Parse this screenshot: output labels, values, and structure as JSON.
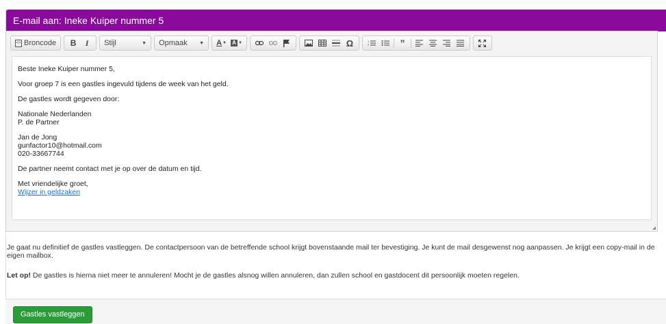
{
  "header": {
    "title": "E-mail aan: Ineke Kuiper nummer 5"
  },
  "toolbar": {
    "source_label": "Broncode",
    "bold_label": "B",
    "italic_label": "I",
    "style_select": "Stijl",
    "format_select": "Opmaak"
  },
  "email": {
    "greeting": "Beste Ineke Kuiper nummer 5,",
    "intro": "Voor groep 7 is een gastles ingevuld tijdens de week van het geld.",
    "given_by": "De gastles wordt gegeven door:",
    "org_line1": "Nationale Nederlanden",
    "org_line2": "P. de Partner",
    "contact_name": "Jan de Jong",
    "contact_email": "gunfactor10@hotmail.com",
    "contact_phone": "020-33667744",
    "followup": "De partner neemt contact met je op over de datum en tijd.",
    "closing": "Met vriendelijke groet,",
    "signature_link": "Wijzer in geldzaken"
  },
  "info_text": "Je gaat nu definitief de gastles vastleggen. De contactpersoon van de betreffende school krijgt bovenstaande mail ter bevestiging. Je kunt de mail desgewenst nog aanpassen. Je krijgt een copy-mail in de eigen mailbox.",
  "warning": {
    "label": "Let op!",
    "text": " De gastles is hierna niet meer te annuleren! Mocht je de gastles alsnog willen annuleren, dan zullen school en gastdocent dit persoonlijk moeten regelen."
  },
  "submit_label": "Gastles vastleggen",
  "colors": {
    "header": "#8a0a9b",
    "submit": "#2a9d3a",
    "link": "#1f6fc5"
  }
}
